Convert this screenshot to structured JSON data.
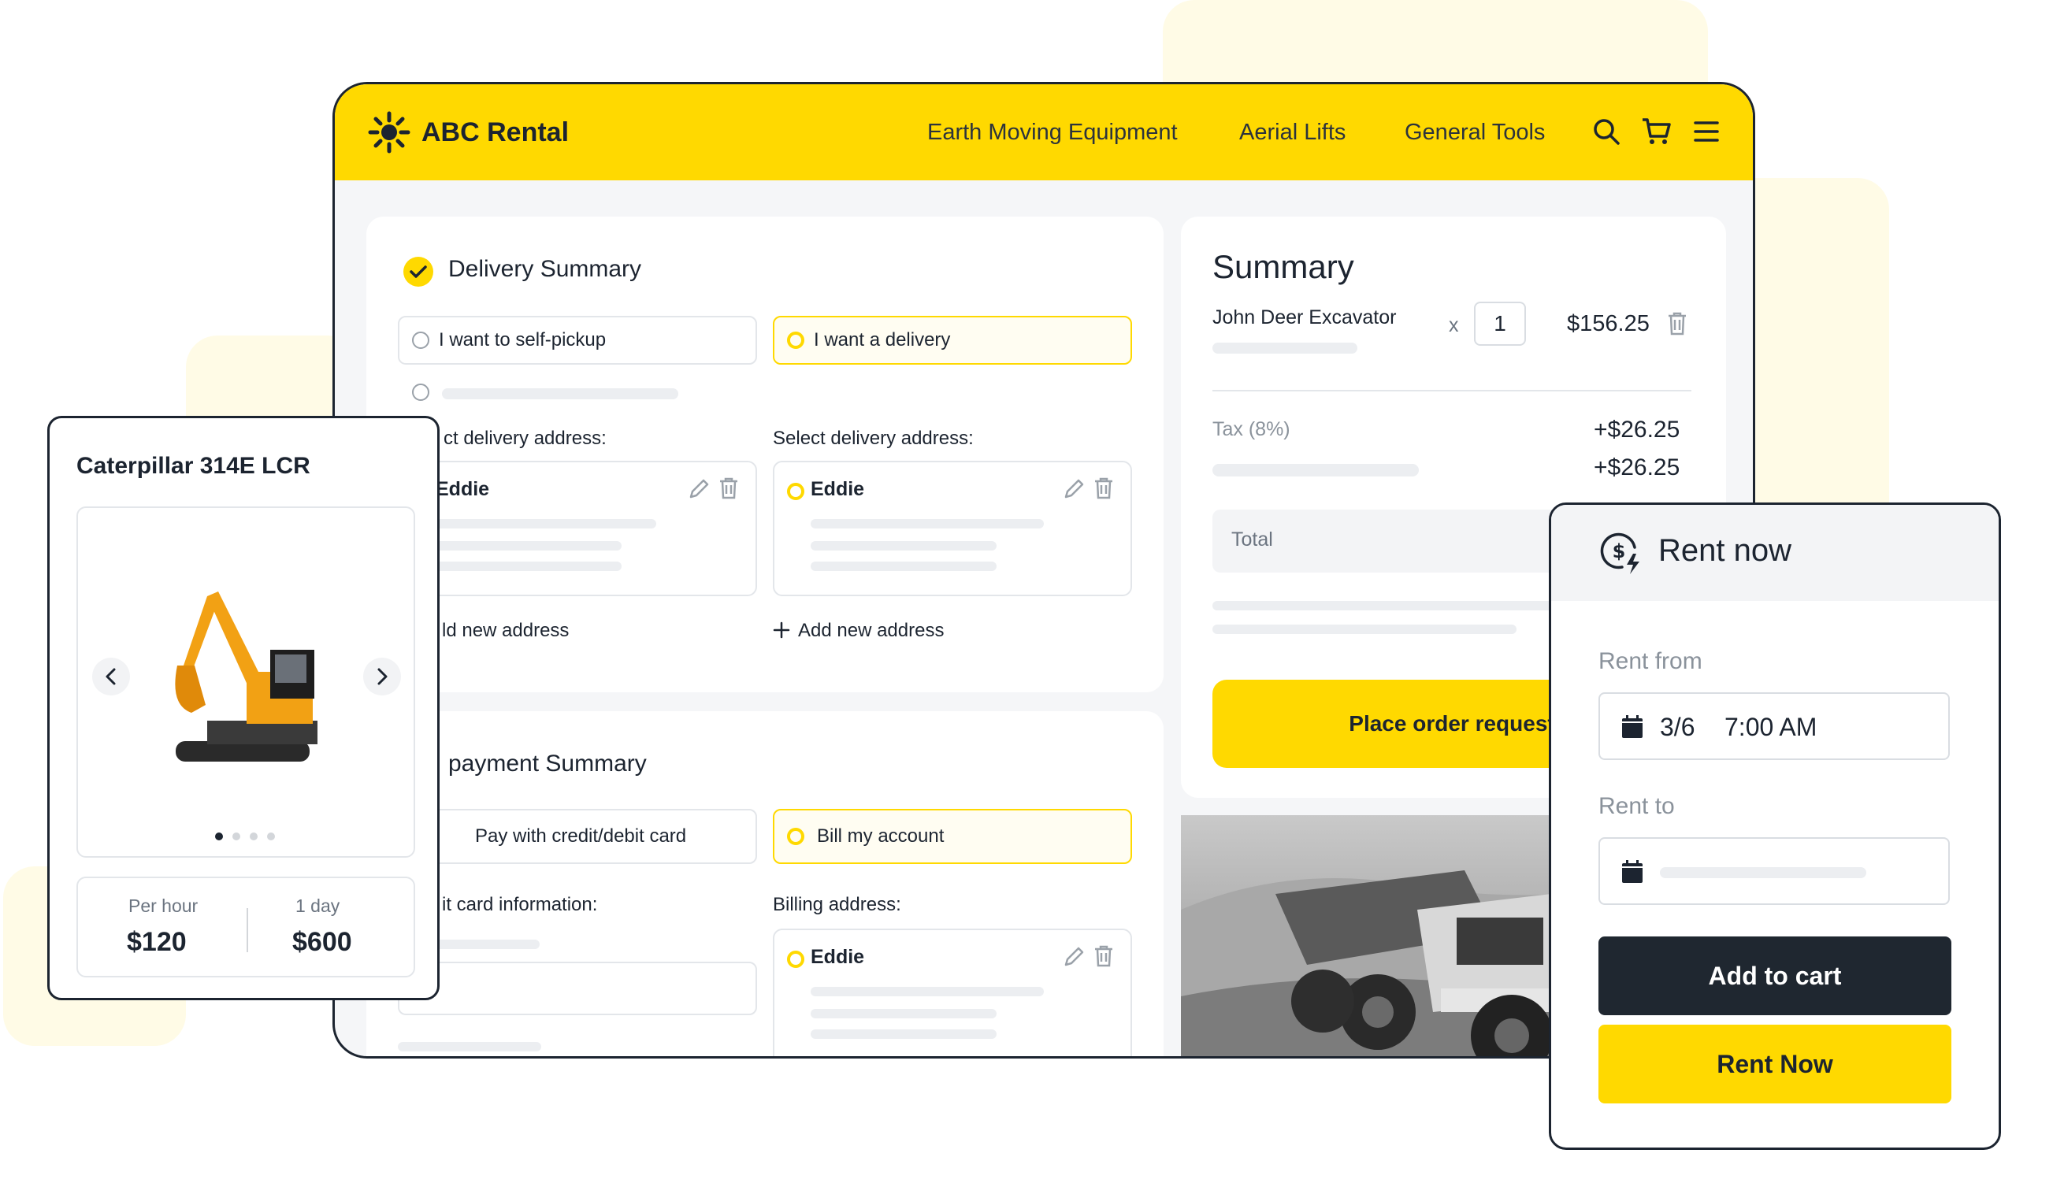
{
  "app": {
    "brand": "ABC Rental"
  },
  "nav": {
    "links": [
      "Earth Moving Equipment",
      "Aerial Lifts",
      "General Tools"
    ]
  },
  "delivery": {
    "title": "Delivery Summary",
    "option_pickup": "I want to self-pickup",
    "option_delivery": "I want a delivery",
    "address_label_left": "ct delivery address:",
    "address_label_right": "Select delivery address:",
    "address_name_left": "Eddie",
    "address_name_right": "Eddie",
    "add_address_left": "ld new address",
    "add_address_right": "Add new address"
  },
  "payment": {
    "title": "payment Summary",
    "option_card": "Pay with credit/debit card",
    "option_bill": "Bill my account",
    "card_info_label": "it card information:",
    "billing_label": "Billing address:",
    "billing_name": "Eddie"
  },
  "summary": {
    "title": "Summary",
    "item_name": "John Deer Excavator",
    "qty_prefix": "x",
    "qty": "1",
    "item_price": "$156.25",
    "tax_label": "Tax (8%)",
    "tax_value": "+$26.25",
    "extra_value": "+$26.25",
    "total_label": "Total",
    "place_order": "Place order request"
  },
  "product": {
    "name": "Caterpillar 314E LCR",
    "per_hour_label": "Per hour",
    "per_hour_price": "$120",
    "per_day_label": "1 day",
    "per_day_price": "$600"
  },
  "rent": {
    "title": "Rent now",
    "from_label": "Rent from",
    "from_date": "3/6",
    "from_time": "7:00 AM",
    "to_label": "Rent to",
    "add_to_cart": "Add to cart",
    "rent_now": "Rent Now"
  },
  "colors": {
    "accent": "#ffd900",
    "dark": "#1f2730",
    "border": "#e3e6ea"
  }
}
